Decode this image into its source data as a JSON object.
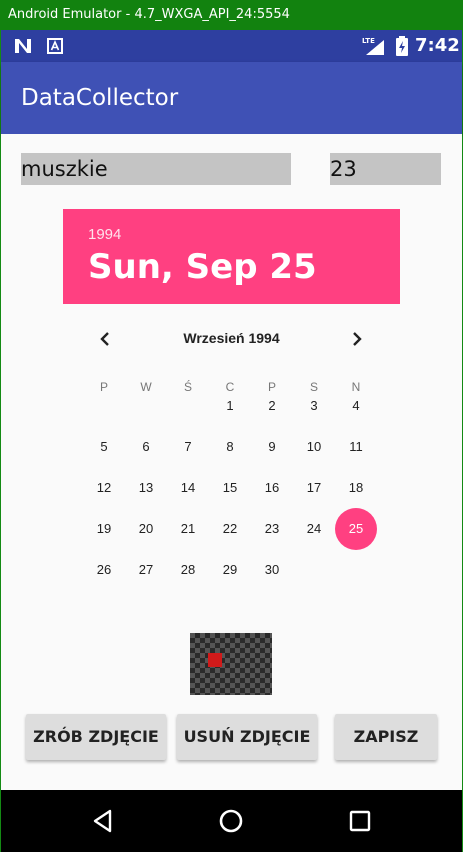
{
  "emulator": {
    "title": "Android Emulator - 4.7_WXGA_API_24:5554"
  },
  "statusbar": {
    "time": "7:42",
    "network": "LTE",
    "icons": [
      "n-notification-icon",
      "a-notification-icon",
      "lte-signal-icon",
      "battery-icon"
    ]
  },
  "appbar": {
    "title": "DataCollector"
  },
  "form": {
    "name_value": "muszkie",
    "number_value": "23"
  },
  "date_picker": {
    "year": "1994",
    "date": "Sun, Sep 25",
    "month_label": "Wrzesień 1994",
    "weekdays": [
      "P",
      "W",
      "Ś",
      "C",
      "P",
      "S",
      "N"
    ],
    "weeks": [
      [
        "",
        "",
        "",
        "1",
        "2",
        "3",
        "4"
      ],
      [
        "5",
        "6",
        "7",
        "8",
        "9",
        "10",
        "11"
      ],
      [
        "12",
        "13",
        "14",
        "15",
        "16",
        "17",
        "18"
      ],
      [
        "19",
        "20",
        "21",
        "22",
        "23",
        "24",
        "25"
      ],
      [
        "26",
        "27",
        "28",
        "29",
        "30",
        "",
        ""
      ]
    ],
    "selected_day": "25",
    "accent_color": "#ff4081"
  },
  "buttons": {
    "take_photo": "ZRÓB ZDJĘCIE",
    "delete_photo": "USUŃ ZDJĘCIE",
    "save": "ZAPISZ"
  },
  "colors": {
    "primary": "#3f51b5",
    "status": "#2e3fa0",
    "accent": "#ff4081"
  }
}
